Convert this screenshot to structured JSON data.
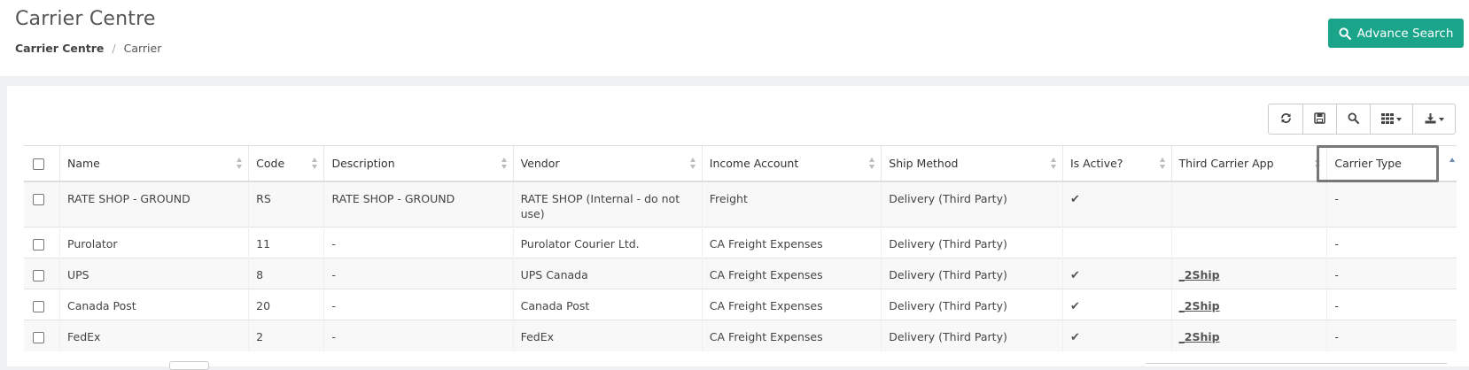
{
  "header": {
    "title": "Carrier Centre",
    "breadcrumb": {
      "root": "Carrier Centre",
      "separator": "/",
      "current": "Carrier"
    },
    "advance_search_label": "Advance Search"
  },
  "toolbar": {
    "buttons": [
      "refresh-icon",
      "save-icon",
      "search-icon",
      "columns-icon",
      "export-icon"
    ]
  },
  "table": {
    "columns": [
      "Name",
      "Code",
      "Description",
      "Vendor",
      "Income Account",
      "Ship Method",
      "Is Active?",
      "Third Carrier App",
      "Carrier Type"
    ],
    "rows": [
      {
        "name": "RATE SHOP - GROUND",
        "code": "RS",
        "description": "RATE SHOP - GROUND",
        "vendor": "RATE SHOP (Internal - do not use)",
        "income_account": "Freight",
        "ship_method": "Delivery (Third Party)",
        "is_active": "✔",
        "third_carrier_app": "",
        "carrier_type": "-"
      },
      {
        "name": "Purolator",
        "code": "11",
        "description": "-",
        "vendor": "Purolator Courier Ltd.",
        "income_account": "CA Freight Expenses",
        "ship_method": "Delivery (Third Party)",
        "is_active": "",
        "third_carrier_app": "",
        "carrier_type": "-"
      },
      {
        "name": "UPS",
        "code": "8",
        "description": "-",
        "vendor": "UPS Canada",
        "income_account": "CA Freight Expenses",
        "ship_method": "Delivery (Third Party)",
        "is_active": "✔",
        "third_carrier_app": "_2Ship",
        "carrier_type": "-"
      },
      {
        "name": "Canada Post",
        "code": "20",
        "description": "-",
        "vendor": "Canada Post",
        "income_account": "CA Freight Expenses",
        "ship_method": "Delivery (Third Party)",
        "is_active": "✔",
        "third_carrier_app": "_2Ship",
        "carrier_type": "-"
      },
      {
        "name": "FedEx",
        "code": "2",
        "description": "-",
        "vendor": "FedEx",
        "income_account": "CA Freight Expenses",
        "ship_method": "Delivery (Third Party)",
        "is_active": "✔",
        "third_carrier_app": "_2Ship",
        "carrier_type": "-"
      }
    ]
  },
  "colors": {
    "accent": "#1aa58a",
    "highlight_border": "#777777"
  }
}
